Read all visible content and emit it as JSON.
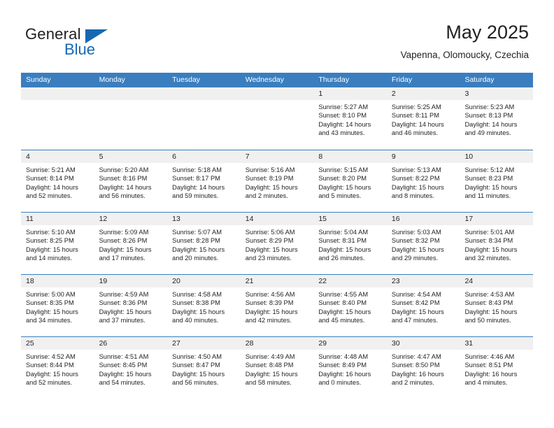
{
  "brand": {
    "name_top": "General",
    "name_bottom": "Blue",
    "triangle_color": "#1668b3"
  },
  "header": {
    "title": "May 2025",
    "subtitle": "Vapenna, Olomoucky, Czechia"
  },
  "theme": {
    "header_blue": "#3a7ebf",
    "daynum_strip": "#f0f0f0",
    "text": "#231f20"
  },
  "weekdays": [
    "Sunday",
    "Monday",
    "Tuesday",
    "Wednesday",
    "Thursday",
    "Friday",
    "Saturday"
  ],
  "weeks": [
    [
      {
        "day": "",
        "empty": true,
        "sunrise": "",
        "sunset": "",
        "daylight1": "",
        "daylight2": ""
      },
      {
        "day": "",
        "empty": true,
        "sunrise": "",
        "sunset": "",
        "daylight1": "",
        "daylight2": ""
      },
      {
        "day": "",
        "empty": true,
        "sunrise": "",
        "sunset": "",
        "daylight1": "",
        "daylight2": ""
      },
      {
        "day": "",
        "empty": true,
        "sunrise": "",
        "sunset": "",
        "daylight1": "",
        "daylight2": ""
      },
      {
        "day": "1",
        "sunrise": "Sunrise: 5:27 AM",
        "sunset": "Sunset: 8:10 PM",
        "daylight1": "Daylight: 14 hours",
        "daylight2": "and 43 minutes."
      },
      {
        "day": "2",
        "sunrise": "Sunrise: 5:25 AM",
        "sunset": "Sunset: 8:11 PM",
        "daylight1": "Daylight: 14 hours",
        "daylight2": "and 46 minutes."
      },
      {
        "day": "3",
        "sunrise": "Sunrise: 5:23 AM",
        "sunset": "Sunset: 8:13 PM",
        "daylight1": "Daylight: 14 hours",
        "daylight2": "and 49 minutes."
      }
    ],
    [
      {
        "day": "4",
        "sunrise": "Sunrise: 5:21 AM",
        "sunset": "Sunset: 8:14 PM",
        "daylight1": "Daylight: 14 hours",
        "daylight2": "and 52 minutes."
      },
      {
        "day": "5",
        "sunrise": "Sunrise: 5:20 AM",
        "sunset": "Sunset: 8:16 PM",
        "daylight1": "Daylight: 14 hours",
        "daylight2": "and 56 minutes."
      },
      {
        "day": "6",
        "sunrise": "Sunrise: 5:18 AM",
        "sunset": "Sunset: 8:17 PM",
        "daylight1": "Daylight: 14 hours",
        "daylight2": "and 59 minutes."
      },
      {
        "day": "7",
        "sunrise": "Sunrise: 5:16 AM",
        "sunset": "Sunset: 8:19 PM",
        "daylight1": "Daylight: 15 hours",
        "daylight2": "and 2 minutes."
      },
      {
        "day": "8",
        "sunrise": "Sunrise: 5:15 AM",
        "sunset": "Sunset: 8:20 PM",
        "daylight1": "Daylight: 15 hours",
        "daylight2": "and 5 minutes."
      },
      {
        "day": "9",
        "sunrise": "Sunrise: 5:13 AM",
        "sunset": "Sunset: 8:22 PM",
        "daylight1": "Daylight: 15 hours",
        "daylight2": "and 8 minutes."
      },
      {
        "day": "10",
        "sunrise": "Sunrise: 5:12 AM",
        "sunset": "Sunset: 8:23 PM",
        "daylight1": "Daylight: 15 hours",
        "daylight2": "and 11 minutes."
      }
    ],
    [
      {
        "day": "11",
        "sunrise": "Sunrise: 5:10 AM",
        "sunset": "Sunset: 8:25 PM",
        "daylight1": "Daylight: 15 hours",
        "daylight2": "and 14 minutes."
      },
      {
        "day": "12",
        "sunrise": "Sunrise: 5:09 AM",
        "sunset": "Sunset: 8:26 PM",
        "daylight1": "Daylight: 15 hours",
        "daylight2": "and 17 minutes."
      },
      {
        "day": "13",
        "sunrise": "Sunrise: 5:07 AM",
        "sunset": "Sunset: 8:28 PM",
        "daylight1": "Daylight: 15 hours",
        "daylight2": "and 20 minutes."
      },
      {
        "day": "14",
        "sunrise": "Sunrise: 5:06 AM",
        "sunset": "Sunset: 8:29 PM",
        "daylight1": "Daylight: 15 hours",
        "daylight2": "and 23 minutes."
      },
      {
        "day": "15",
        "sunrise": "Sunrise: 5:04 AM",
        "sunset": "Sunset: 8:31 PM",
        "daylight1": "Daylight: 15 hours",
        "daylight2": "and 26 minutes."
      },
      {
        "day": "16",
        "sunrise": "Sunrise: 5:03 AM",
        "sunset": "Sunset: 8:32 PM",
        "daylight1": "Daylight: 15 hours",
        "daylight2": "and 29 minutes."
      },
      {
        "day": "17",
        "sunrise": "Sunrise: 5:01 AM",
        "sunset": "Sunset: 8:34 PM",
        "daylight1": "Daylight: 15 hours",
        "daylight2": "and 32 minutes."
      }
    ],
    [
      {
        "day": "18",
        "sunrise": "Sunrise: 5:00 AM",
        "sunset": "Sunset: 8:35 PM",
        "daylight1": "Daylight: 15 hours",
        "daylight2": "and 34 minutes."
      },
      {
        "day": "19",
        "sunrise": "Sunrise: 4:59 AM",
        "sunset": "Sunset: 8:36 PM",
        "daylight1": "Daylight: 15 hours",
        "daylight2": "and 37 minutes."
      },
      {
        "day": "20",
        "sunrise": "Sunrise: 4:58 AM",
        "sunset": "Sunset: 8:38 PM",
        "daylight1": "Daylight: 15 hours",
        "daylight2": "and 40 minutes."
      },
      {
        "day": "21",
        "sunrise": "Sunrise: 4:56 AM",
        "sunset": "Sunset: 8:39 PM",
        "daylight1": "Daylight: 15 hours",
        "daylight2": "and 42 minutes."
      },
      {
        "day": "22",
        "sunrise": "Sunrise: 4:55 AM",
        "sunset": "Sunset: 8:40 PM",
        "daylight1": "Daylight: 15 hours",
        "daylight2": "and 45 minutes."
      },
      {
        "day": "23",
        "sunrise": "Sunrise: 4:54 AM",
        "sunset": "Sunset: 8:42 PM",
        "daylight1": "Daylight: 15 hours",
        "daylight2": "and 47 minutes."
      },
      {
        "day": "24",
        "sunrise": "Sunrise: 4:53 AM",
        "sunset": "Sunset: 8:43 PM",
        "daylight1": "Daylight: 15 hours",
        "daylight2": "and 50 minutes."
      }
    ],
    [
      {
        "day": "25",
        "sunrise": "Sunrise: 4:52 AM",
        "sunset": "Sunset: 8:44 PM",
        "daylight1": "Daylight: 15 hours",
        "daylight2": "and 52 minutes."
      },
      {
        "day": "26",
        "sunrise": "Sunrise: 4:51 AM",
        "sunset": "Sunset: 8:45 PM",
        "daylight1": "Daylight: 15 hours",
        "daylight2": "and 54 minutes."
      },
      {
        "day": "27",
        "sunrise": "Sunrise: 4:50 AM",
        "sunset": "Sunset: 8:47 PM",
        "daylight1": "Daylight: 15 hours",
        "daylight2": "and 56 minutes."
      },
      {
        "day": "28",
        "sunrise": "Sunrise: 4:49 AM",
        "sunset": "Sunset: 8:48 PM",
        "daylight1": "Daylight: 15 hours",
        "daylight2": "and 58 minutes."
      },
      {
        "day": "29",
        "sunrise": "Sunrise: 4:48 AM",
        "sunset": "Sunset: 8:49 PM",
        "daylight1": "Daylight: 16 hours",
        "daylight2": "and 0 minutes."
      },
      {
        "day": "30",
        "sunrise": "Sunrise: 4:47 AM",
        "sunset": "Sunset: 8:50 PM",
        "daylight1": "Daylight: 16 hours",
        "daylight2": "and 2 minutes."
      },
      {
        "day": "31",
        "sunrise": "Sunrise: 4:46 AM",
        "sunset": "Sunset: 8:51 PM",
        "daylight1": "Daylight: 16 hours",
        "daylight2": "and 4 minutes."
      }
    ]
  ]
}
